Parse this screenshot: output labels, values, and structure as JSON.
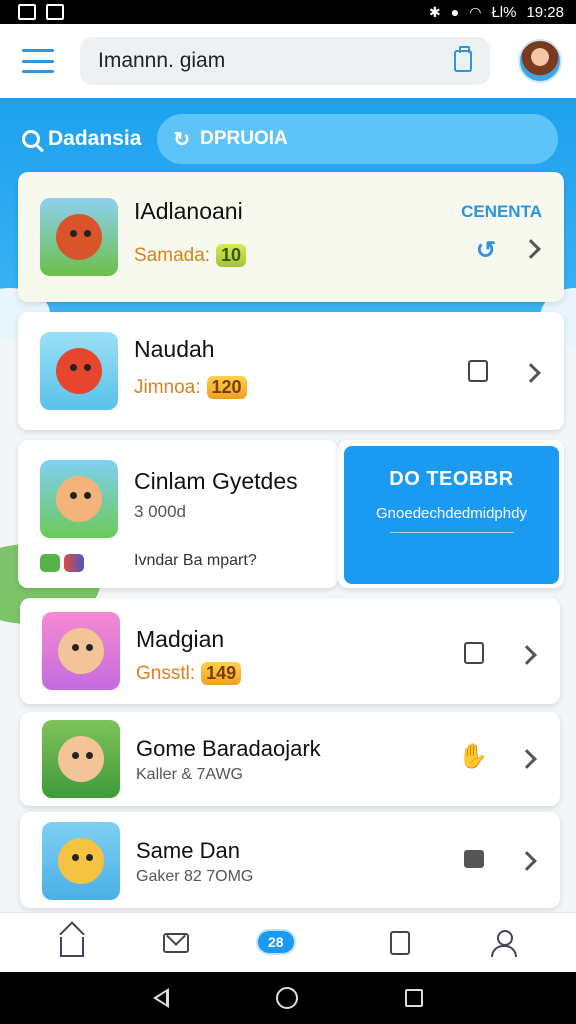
{
  "status_bar": {
    "time": "19:28",
    "signal_text": "Łl%"
  },
  "header": {
    "search_value": "Imannn. giam"
  },
  "filter": {
    "label": "Dadansia",
    "pill_text": "DPRUOIA"
  },
  "games": [
    {
      "title": "IAdlanoani",
      "sub_label": "Samada:",
      "badge": "10",
      "status": "CENENTA"
    },
    {
      "title": "Naudah",
      "sub_label": "Jimnoa:",
      "badge": "120"
    },
    {
      "title": "Cinlam Gyetdes",
      "sub_label": "3 000d",
      "note": "Ivndar Ba mpart?"
    },
    {
      "title": "Madgian",
      "sub_label": "Gnsstl:",
      "badge": "149"
    },
    {
      "title": "Gome Baradaojark",
      "sub_label": "Kaller & 7AWG"
    },
    {
      "title": "Same Dan",
      "sub_label": "Gaker 82 7OMG"
    }
  ],
  "promo": {
    "heading": "DO TEOBBR",
    "description": "Gnoedechdedmidphdy"
  },
  "bottom_nav": {
    "badge": "28"
  },
  "icons": {
    "menu": "hamburger-icon",
    "clipboard": "clipboard-icon",
    "search": "search-icon",
    "link": "link-icon",
    "chevron": "chevron-right-icon",
    "home": "home-icon",
    "mail": "mail-icon",
    "doc": "document-icon",
    "profile": "profile-icon"
  },
  "colors": {
    "accent": "#1a9af0",
    "badge_orange": "#f0a020",
    "status_blue": "#2c95dd"
  }
}
